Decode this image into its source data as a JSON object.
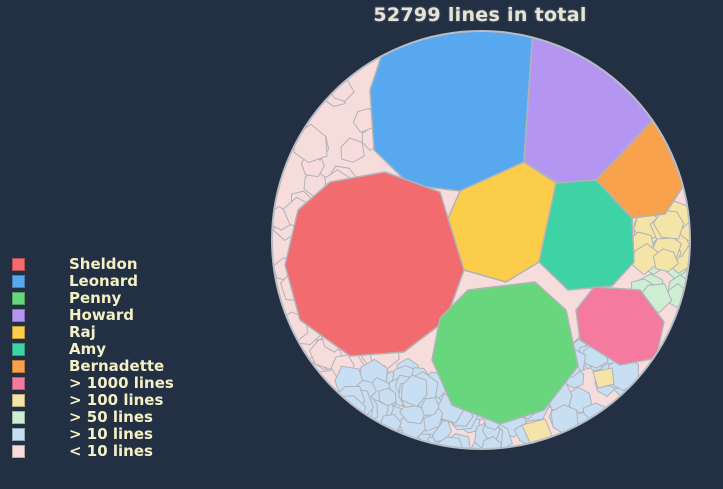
{
  "chart_data": {
    "type": "voronoi-treemap",
    "title": "52799 lines in total",
    "legend_position": "left",
    "legend": [
      {
        "label": "Sheldon",
        "color": "#f26b6e"
      },
      {
        "label": "Leonard",
        "color": "#58a8f0"
      },
      {
        "label": "Penny",
        "color": "#68d67c"
      },
      {
        "label": "Howard",
        "color": "#b496f2"
      },
      {
        "label": "Raj",
        "color": "#fbcd4a"
      },
      {
        "label": "Amy",
        "color": "#3fd2a4"
      },
      {
        "label": "Bernadette",
        "color": "#f8a24e"
      },
      {
        "label": "> 1000 lines",
        "color": "#f57aa0"
      },
      {
        "label": "> 100 lines",
        "color": "#f5e4a8"
      },
      {
        "label": "> 50 lines",
        "color": "#cdeed2"
      },
      {
        "label": "> 10 lines",
        "color": "#c7def3"
      },
      {
        "label": "< 10 lines",
        "color": "#f7dcdc"
      }
    ]
  }
}
